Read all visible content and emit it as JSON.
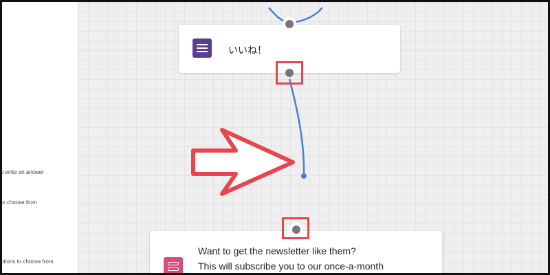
{
  "sidebar": {
    "hints": [
      "o write an answer",
      "to choose from",
      "ptions to choose from"
    ]
  },
  "cards": {
    "first": {
      "title": "いいね！"
    },
    "second": {
      "line1": "Want to get the newsletter like them?",
      "line2": "This will subscribe you to our once-a-month"
    }
  },
  "colors": {
    "highlight": "#e8454d",
    "connector": "#4a7fd0",
    "card1_icon": "#5b3f8e",
    "card2_icon": "#d94c7a"
  }
}
